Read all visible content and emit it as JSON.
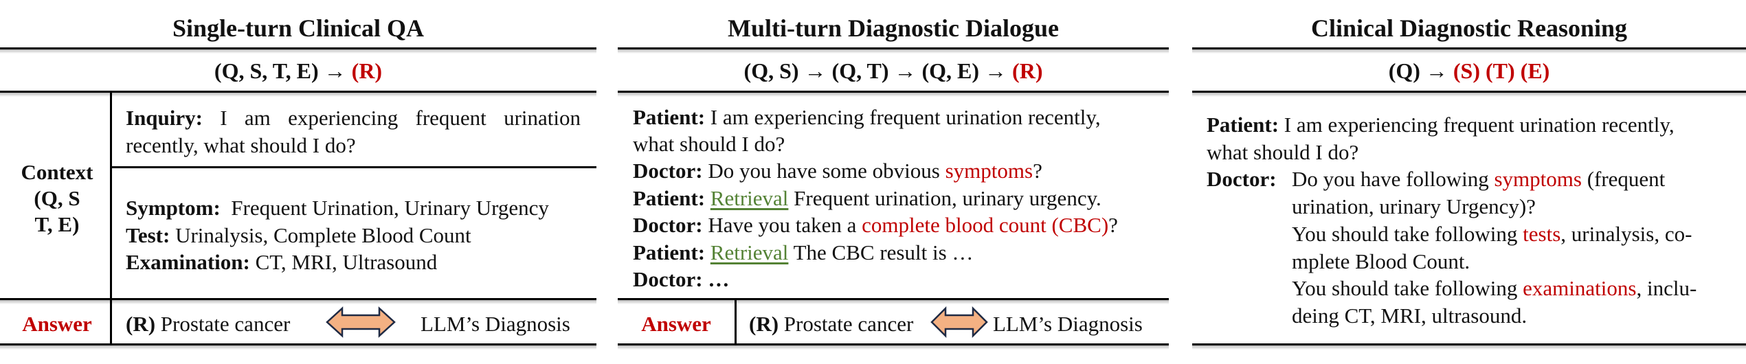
{
  "panel1": {
    "title": "Single-turn Clinical QA",
    "formula_prefix": "(Q, S, T, E) ",
    "formula_arrow": "→",
    "formula_result": "(R)",
    "context_label": [
      "Context",
      "(Q, S",
      "T, E)"
    ],
    "inquiry_label": "Inquiry:",
    "inquiry_text": "I am experiencing frequent urination recently, what should I do?",
    "symptom_label": "Symptom:",
    "symptom_text": "Frequent Urination, Urinary Urgency",
    "test_label": "Test:",
    "test_text": "Urinalysis, Complete Blood Count",
    "exam_label": "Examination:",
    "exam_text": "CT, MRI, Ultrasound",
    "answer_label": "Answer",
    "answer_r": "(R)",
    "answer_text": "Prostate cancer",
    "diagnosis_text": "LLM’s Diagnosis"
  },
  "panel2": {
    "title": "Multi-turn Diagnostic Dialogue",
    "formula": [
      "(Q, S) ",
      "→",
      " (Q, T) ",
      "→",
      " (Q, E) ",
      "→",
      " ",
      "(R)"
    ],
    "lines": [
      {
        "speaker": "Patient:",
        "text": "I am experiencing frequent urination recently,"
      },
      {
        "speaker": "",
        "text": "what should I do?"
      },
      {
        "speaker": "Doctor:",
        "pre": "Do you have some obvious ",
        "hl": "symptoms",
        "post": "?"
      },
      {
        "speaker": "Patient:",
        "retrieval": "Retrieval",
        "text": "Frequent urination, urinary urgency."
      },
      {
        "speaker": "Doctor:",
        "pre": "Have you taken a ",
        "hl": "complete blood count (CBC)",
        "post": "?"
      },
      {
        "speaker": "Patient:",
        "retrieval": "Retrieval",
        "text": "The CBC result is …"
      },
      {
        "speaker": "Doctor:",
        "text": "…"
      }
    ],
    "answer_label": "Answer",
    "answer_r": "(R)",
    "answer_text": "Prostate cancer",
    "diagnosis_text": "LLM’s Diagnosis"
  },
  "panel3": {
    "title": "Clinical Diagnostic Reasoning",
    "formula_prefix": "(Q) ",
    "formula_arrow": "→",
    "formula_result": "(S) (T) (E)",
    "patient_label": "Patient:",
    "patient_line1": "I am experiencing frequent urination recently,",
    "patient_line2": "what should I do?",
    "doctor_label": "Doctor:",
    "d1_pre": "Do you have following ",
    "d1_hl": "symptoms",
    "d1_post": " (frequent",
    "d2": "urination, urinary Urgency)?",
    "d3_pre": "You should take following ",
    "d3_hl": "tests",
    "d3_post": ", urinalysis, co-",
    "d4": "mplete Blood Count.",
    "d5_pre": "You should take following ",
    "d5_hl": "examinations",
    "d5_post": ", inclu-",
    "d6": "deing CT, MRI, ultrasound."
  },
  "colors": {
    "highlight": "#c00000",
    "retrieval": "#548235",
    "arrow_fill": "#f4b183",
    "arrow_stroke": "#1f2a44"
  }
}
